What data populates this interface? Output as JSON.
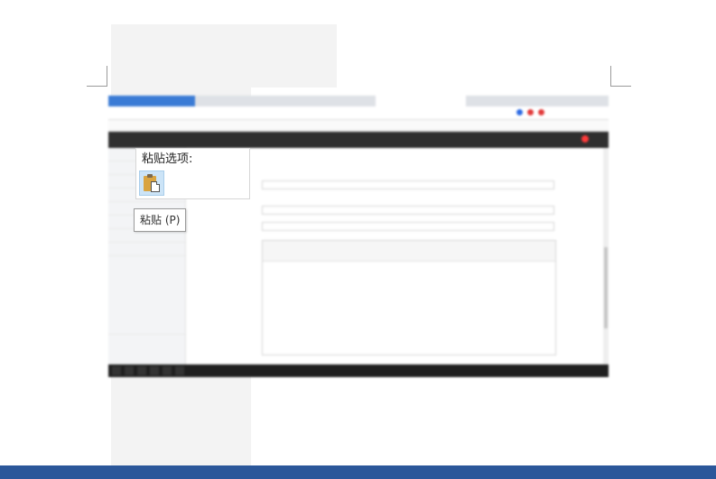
{
  "paste_menu": {
    "title": "粘贴选项:",
    "tooltip": "粘贴 (P)",
    "icon": "clipboard-paste-icon"
  },
  "colors": {
    "status_bar": "#2b579a",
    "selected_option": "#cce4f7",
    "app_header": "#2f2f2f"
  }
}
